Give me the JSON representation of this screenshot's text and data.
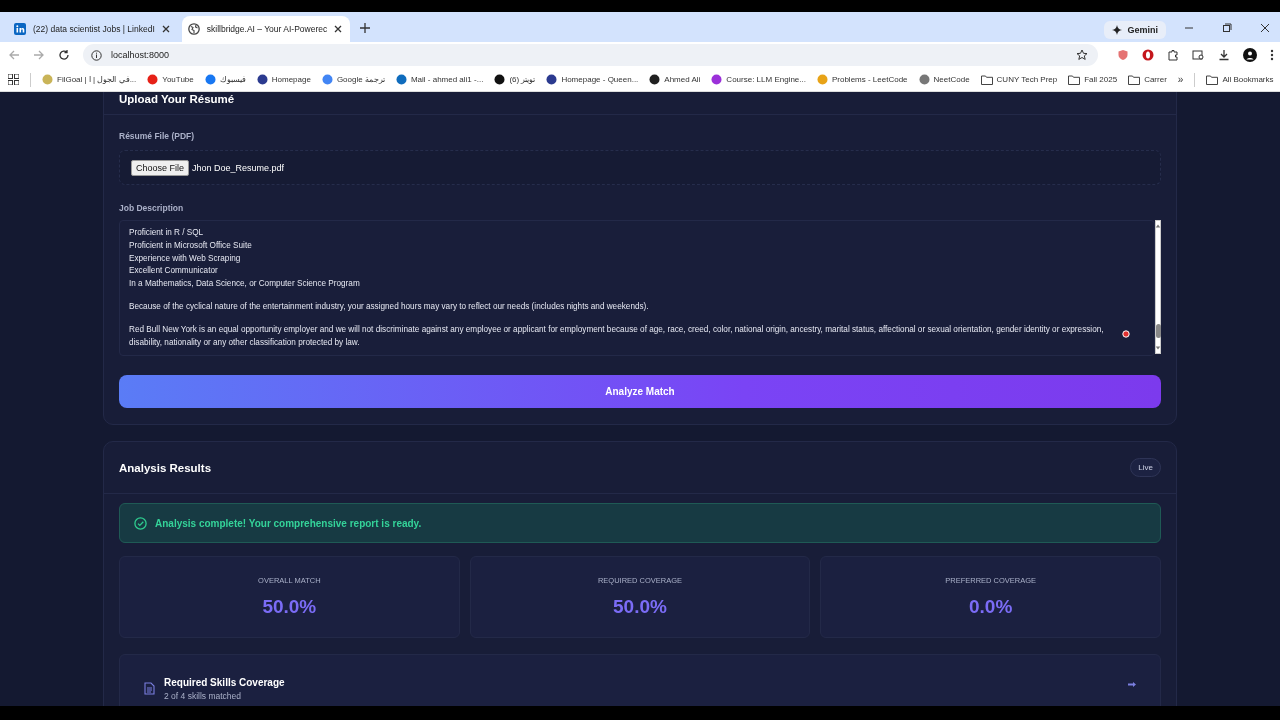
{
  "browser": {
    "tabs": [
      {
        "title": "(22) data scientist Jobs | LinkedI",
        "selected": false,
        "kind": "linkedin"
      },
      {
        "title": "skillbridge.AI – Your AI-Powerec",
        "selected": true,
        "kind": "globe"
      }
    ],
    "address": "localhost:8000",
    "assistant": "Gemini",
    "bookmarks": [
      {
        "label": "FilGoal | في الجول | ا...",
        "kind": "site",
        "color": "#c9b458"
      },
      {
        "label": "YouTube",
        "kind": "site",
        "color": "#e62117"
      },
      {
        "label": "فيسبوك",
        "kind": "site",
        "color": "#1877f2"
      },
      {
        "label": "Homepage",
        "kind": "site",
        "color": "#2b3a8f"
      },
      {
        "label": "Google ترجمة",
        "kind": "site",
        "color": "#4285f4"
      },
      {
        "label": "Mail - ahmed ali1 -...",
        "kind": "site",
        "color": "#0f6cbd"
      },
      {
        "label": "تويتر (6)",
        "kind": "site",
        "color": "#111111"
      },
      {
        "label": "Homepage - Queen...",
        "kind": "site",
        "color": "#2b3a8f"
      },
      {
        "label": "Ahmed Ali",
        "kind": "site",
        "color": "#202020"
      },
      {
        "label": "Course: LLM Engine...",
        "kind": "site",
        "color": "#9b30d9"
      },
      {
        "label": "Problems - LeetCode",
        "kind": "site",
        "color": "#e8a317"
      },
      {
        "label": "NeetCode",
        "kind": "site",
        "color": "#777777"
      },
      {
        "label": "CUNY Tech Prep",
        "kind": "folder",
        "color": "#444444"
      },
      {
        "label": "Fall 2025",
        "kind": "folder",
        "color": "#444444"
      },
      {
        "label": "Carrer",
        "kind": "folder",
        "color": "#444444"
      }
    ],
    "more": "»",
    "all_bookmarks": "All Bookmarks"
  },
  "upload": {
    "title": "Upload Your Résumé",
    "file_label": "Résumé File (PDF)",
    "choose_button": "Choose File",
    "file_name": "Jhon Doe_Resume.pdf",
    "jd_label": "Job Description",
    "jd_paragraphs": [
      [
        "Proficient in R / SQL",
        "Proficient in Microsoft Office Suite",
        "Experience with Web Scraping",
        "Excellent Communicator",
        "In a Mathematics, Data Science, or Computer Science Program"
      ],
      [
        "Because of the cyclical nature of the entertainment industry, your assigned hours may vary to reflect our needs (includes nights and weekends)."
      ],
      [
        "Red Bull New York is an equal opportunity employer and we will not discriminate against any employee or applicant for employment because of age, race, creed, color, national origin, ancestry, marital status, affectional or sexual orientation, gender identity or expression, disability, nationality or any other classification protected by law."
      ]
    ],
    "analyze_button": "Analyze Match"
  },
  "results": {
    "title": "Analysis Results",
    "badge": "Live",
    "alert": "Analysis complete! Your comprehensive report is ready.",
    "metrics": [
      {
        "label": "OVERALL MATCH",
        "value": "50.0%"
      },
      {
        "label": "REQUIRED COVERAGE",
        "value": "50.0%"
      },
      {
        "label": "PREFERRED COVERAGE",
        "value": "0.0%"
      }
    ],
    "skills": {
      "title": "Required Skills Coverage",
      "subtitle": "2 of 4 skills matched"
    }
  }
}
